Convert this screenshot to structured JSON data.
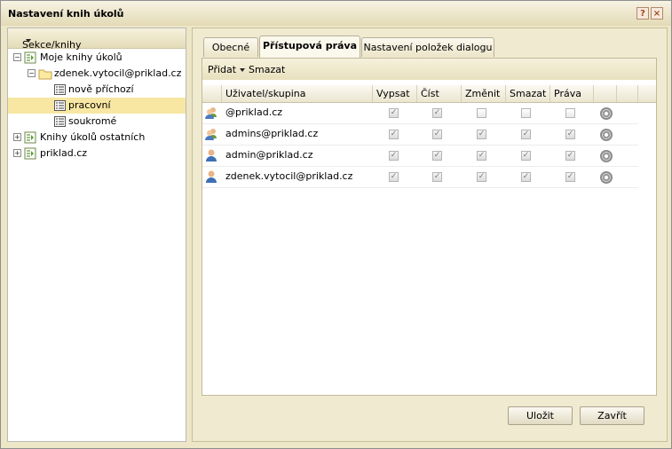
{
  "window": {
    "title": "Nastavení knih úkolů",
    "help_label": "?",
    "close_label": "×"
  },
  "sidebar": {
    "header": "Sekce/knihy",
    "tree": [
      {
        "label": "Moje knihy úkolů"
      },
      {
        "label": "zdenek.vytocil@priklad.cz"
      },
      {
        "label": "nově příchozí"
      },
      {
        "label": "pracovní",
        "selected": true
      },
      {
        "label": "soukromé"
      },
      {
        "label": "Knihy úkolů ostatních"
      },
      {
        "label": "priklad.cz"
      }
    ]
  },
  "tabs": [
    {
      "label": "Obecné"
    },
    {
      "label": "Přístupová práva",
      "active": true
    },
    {
      "label": "Nastavení položek dialogu"
    }
  ],
  "toolbar": {
    "add_label": "Přidat",
    "delete_label": "Smazat"
  },
  "table": {
    "headers": [
      "Uživatel/skupina",
      "Vypsat",
      "Číst",
      "Změnit",
      "Smazat",
      "Práva"
    ],
    "rows": [
      {
        "name": "@priklad.cz",
        "icon": "group-icon",
        "perms": [
          true,
          true,
          false,
          false,
          false
        ]
      },
      {
        "name": "admins@priklad.cz",
        "icon": "group-icon",
        "perms": [
          true,
          true,
          true,
          true,
          true
        ]
      },
      {
        "name": "admin@priklad.cz",
        "icon": "user-icon",
        "perms": [
          true,
          true,
          true,
          true,
          true
        ]
      },
      {
        "name": "zdenek.vytocil@priklad.cz",
        "icon": "user-icon",
        "perms": [
          true,
          true,
          true,
          true,
          true
        ]
      }
    ]
  },
  "buttons": {
    "save_label": "Uložit",
    "close_label": "Zavřít"
  }
}
